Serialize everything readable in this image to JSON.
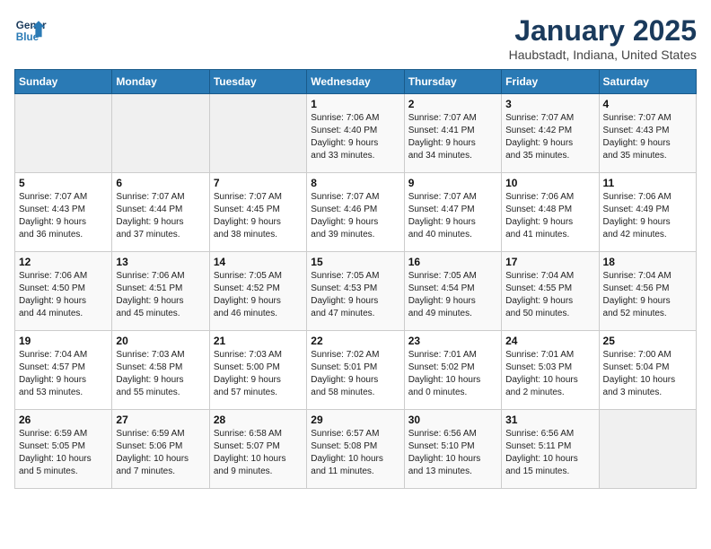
{
  "logo": {
    "line1": "General",
    "line2": "Blue"
  },
  "title": "January 2025",
  "subtitle": "Haubstadt, Indiana, United States",
  "weekdays": [
    "Sunday",
    "Monday",
    "Tuesday",
    "Wednesday",
    "Thursday",
    "Friday",
    "Saturday"
  ],
  "weeks": [
    [
      {
        "day": "",
        "info": ""
      },
      {
        "day": "",
        "info": ""
      },
      {
        "day": "",
        "info": ""
      },
      {
        "day": "1",
        "info": "Sunrise: 7:06 AM\nSunset: 4:40 PM\nDaylight: 9 hours\nand 33 minutes."
      },
      {
        "day": "2",
        "info": "Sunrise: 7:07 AM\nSunset: 4:41 PM\nDaylight: 9 hours\nand 34 minutes."
      },
      {
        "day": "3",
        "info": "Sunrise: 7:07 AM\nSunset: 4:42 PM\nDaylight: 9 hours\nand 35 minutes."
      },
      {
        "day": "4",
        "info": "Sunrise: 7:07 AM\nSunset: 4:43 PM\nDaylight: 9 hours\nand 35 minutes."
      }
    ],
    [
      {
        "day": "5",
        "info": "Sunrise: 7:07 AM\nSunset: 4:43 PM\nDaylight: 9 hours\nand 36 minutes."
      },
      {
        "day": "6",
        "info": "Sunrise: 7:07 AM\nSunset: 4:44 PM\nDaylight: 9 hours\nand 37 minutes."
      },
      {
        "day": "7",
        "info": "Sunrise: 7:07 AM\nSunset: 4:45 PM\nDaylight: 9 hours\nand 38 minutes."
      },
      {
        "day": "8",
        "info": "Sunrise: 7:07 AM\nSunset: 4:46 PM\nDaylight: 9 hours\nand 39 minutes."
      },
      {
        "day": "9",
        "info": "Sunrise: 7:07 AM\nSunset: 4:47 PM\nDaylight: 9 hours\nand 40 minutes."
      },
      {
        "day": "10",
        "info": "Sunrise: 7:06 AM\nSunset: 4:48 PM\nDaylight: 9 hours\nand 41 minutes."
      },
      {
        "day": "11",
        "info": "Sunrise: 7:06 AM\nSunset: 4:49 PM\nDaylight: 9 hours\nand 42 minutes."
      }
    ],
    [
      {
        "day": "12",
        "info": "Sunrise: 7:06 AM\nSunset: 4:50 PM\nDaylight: 9 hours\nand 44 minutes."
      },
      {
        "day": "13",
        "info": "Sunrise: 7:06 AM\nSunset: 4:51 PM\nDaylight: 9 hours\nand 45 minutes."
      },
      {
        "day": "14",
        "info": "Sunrise: 7:05 AM\nSunset: 4:52 PM\nDaylight: 9 hours\nand 46 minutes."
      },
      {
        "day": "15",
        "info": "Sunrise: 7:05 AM\nSunset: 4:53 PM\nDaylight: 9 hours\nand 47 minutes."
      },
      {
        "day": "16",
        "info": "Sunrise: 7:05 AM\nSunset: 4:54 PM\nDaylight: 9 hours\nand 49 minutes."
      },
      {
        "day": "17",
        "info": "Sunrise: 7:04 AM\nSunset: 4:55 PM\nDaylight: 9 hours\nand 50 minutes."
      },
      {
        "day": "18",
        "info": "Sunrise: 7:04 AM\nSunset: 4:56 PM\nDaylight: 9 hours\nand 52 minutes."
      }
    ],
    [
      {
        "day": "19",
        "info": "Sunrise: 7:04 AM\nSunset: 4:57 PM\nDaylight: 9 hours\nand 53 minutes."
      },
      {
        "day": "20",
        "info": "Sunrise: 7:03 AM\nSunset: 4:58 PM\nDaylight: 9 hours\nand 55 minutes."
      },
      {
        "day": "21",
        "info": "Sunrise: 7:03 AM\nSunset: 5:00 PM\nDaylight: 9 hours\nand 57 minutes."
      },
      {
        "day": "22",
        "info": "Sunrise: 7:02 AM\nSunset: 5:01 PM\nDaylight: 9 hours\nand 58 minutes."
      },
      {
        "day": "23",
        "info": "Sunrise: 7:01 AM\nSunset: 5:02 PM\nDaylight: 10 hours\nand 0 minutes."
      },
      {
        "day": "24",
        "info": "Sunrise: 7:01 AM\nSunset: 5:03 PM\nDaylight: 10 hours\nand 2 minutes."
      },
      {
        "day": "25",
        "info": "Sunrise: 7:00 AM\nSunset: 5:04 PM\nDaylight: 10 hours\nand 3 minutes."
      }
    ],
    [
      {
        "day": "26",
        "info": "Sunrise: 6:59 AM\nSunset: 5:05 PM\nDaylight: 10 hours\nand 5 minutes."
      },
      {
        "day": "27",
        "info": "Sunrise: 6:59 AM\nSunset: 5:06 PM\nDaylight: 10 hours\nand 7 minutes."
      },
      {
        "day": "28",
        "info": "Sunrise: 6:58 AM\nSunset: 5:07 PM\nDaylight: 10 hours\nand 9 minutes."
      },
      {
        "day": "29",
        "info": "Sunrise: 6:57 AM\nSunset: 5:08 PM\nDaylight: 10 hours\nand 11 minutes."
      },
      {
        "day": "30",
        "info": "Sunrise: 6:56 AM\nSunset: 5:10 PM\nDaylight: 10 hours\nand 13 minutes."
      },
      {
        "day": "31",
        "info": "Sunrise: 6:56 AM\nSunset: 5:11 PM\nDaylight: 10 hours\nand 15 minutes."
      },
      {
        "day": "",
        "info": ""
      }
    ]
  ]
}
